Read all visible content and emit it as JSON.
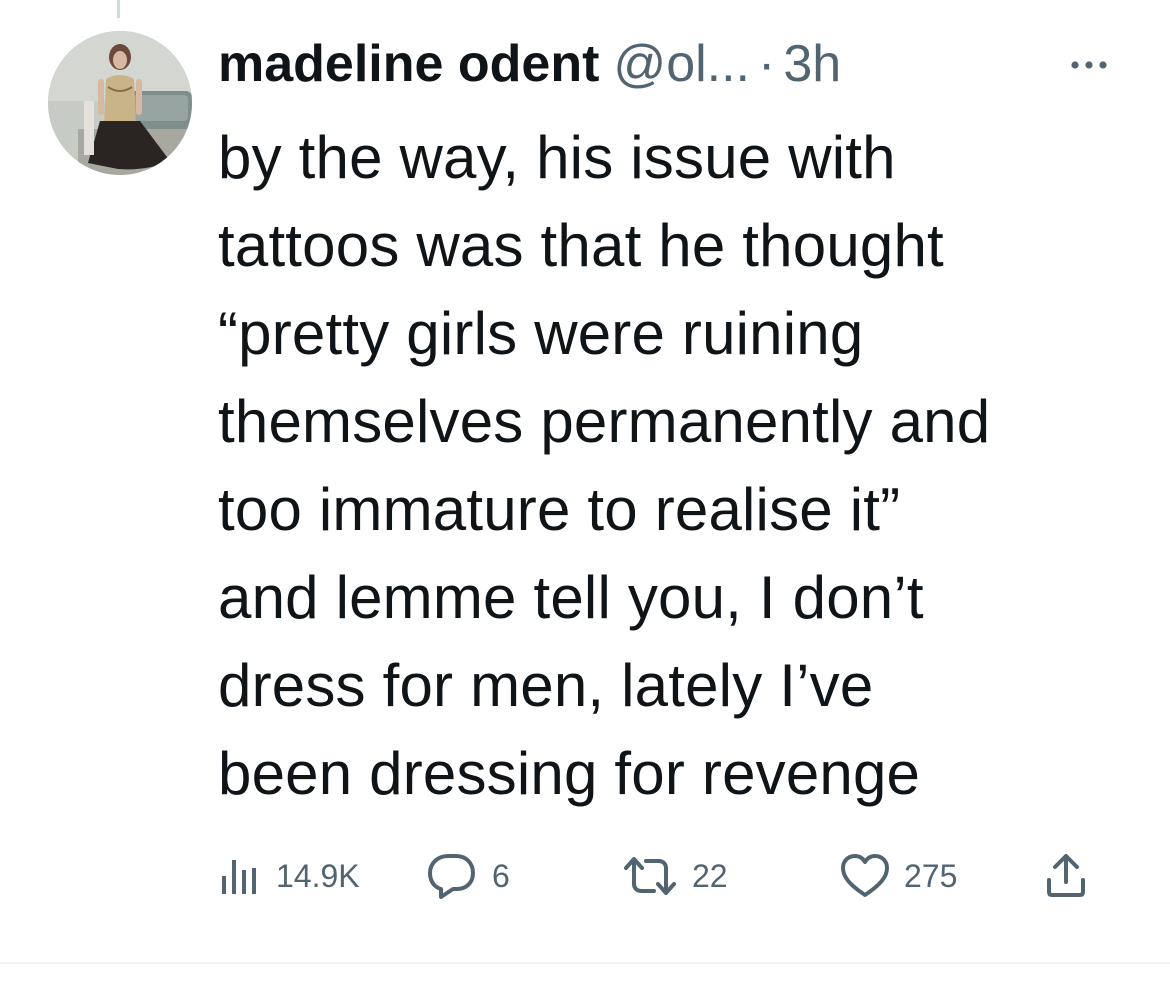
{
  "tweet": {
    "author": {
      "display_name": "madeline odent",
      "handle": "@ol...",
      "separator": "·",
      "timestamp": "3h",
      "avatar_icon": "profile-photo"
    },
    "more_icon": "more-horizontal-icon",
    "text": "by the way, his issue with\ntattoos was that he thought\n“pretty girls were ruining\nthemselves permanently and\ntoo immature to realise it”\nand lemme tell you, I don’t\ndress for men, lately I’ve\nbeen dressing for revenge",
    "metrics": {
      "views": "14.9K",
      "replies": "6",
      "retweets": "22",
      "likes": "275"
    },
    "icons": {
      "views": "analytics-icon",
      "reply": "reply-icon",
      "retweet": "retweet-icon",
      "like": "heart-icon",
      "share": "share-icon"
    },
    "colors": {
      "text_primary": "#0f1419",
      "text_secondary": "#536471",
      "divider": "#eff3f4",
      "thread_line": "#cfd9de"
    }
  }
}
